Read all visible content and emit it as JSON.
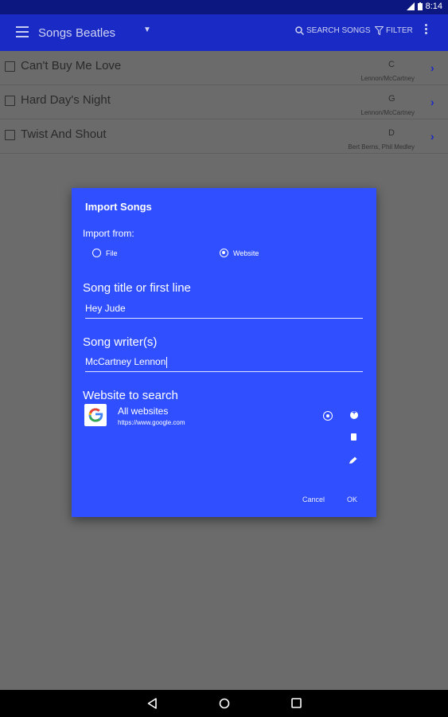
{
  "status_bar": {
    "time": "8:14"
  },
  "app_bar": {
    "title": "Songs",
    "songbook": "Beatles",
    "search_label": "SEARCH SONGS",
    "filter_label": "FILTER"
  },
  "songs": [
    {
      "title": "Can't Buy Me Love",
      "key": "C",
      "writers": "Lennon/McCartney"
    },
    {
      "title": "Hard Day's Night",
      "key": "G",
      "writers": "Lennon/McCartney"
    },
    {
      "title": "Twist And Shout",
      "key": "D",
      "writers": "Bert Berns, Phil Medley"
    }
  ],
  "dialog": {
    "title": "Import Songs",
    "import_from_label": "Import from:",
    "option_file": "File",
    "option_website": "Website",
    "selected_option": "Website",
    "song_title_label": "Song title or first line",
    "song_title_value": "Hey Jude",
    "writers_label": "Song writer(s)",
    "writers_value": "McCartney Lennon",
    "website_label": "Website to search",
    "website": {
      "name": "All websites",
      "url": "https://www.google.com"
    },
    "cancel_label": "Cancel",
    "ok_label": "OK"
  },
  "colors": {
    "app_bar": "#1a2ac4",
    "dialog": "#304ffe",
    "scrim": "#6b6b6b"
  }
}
